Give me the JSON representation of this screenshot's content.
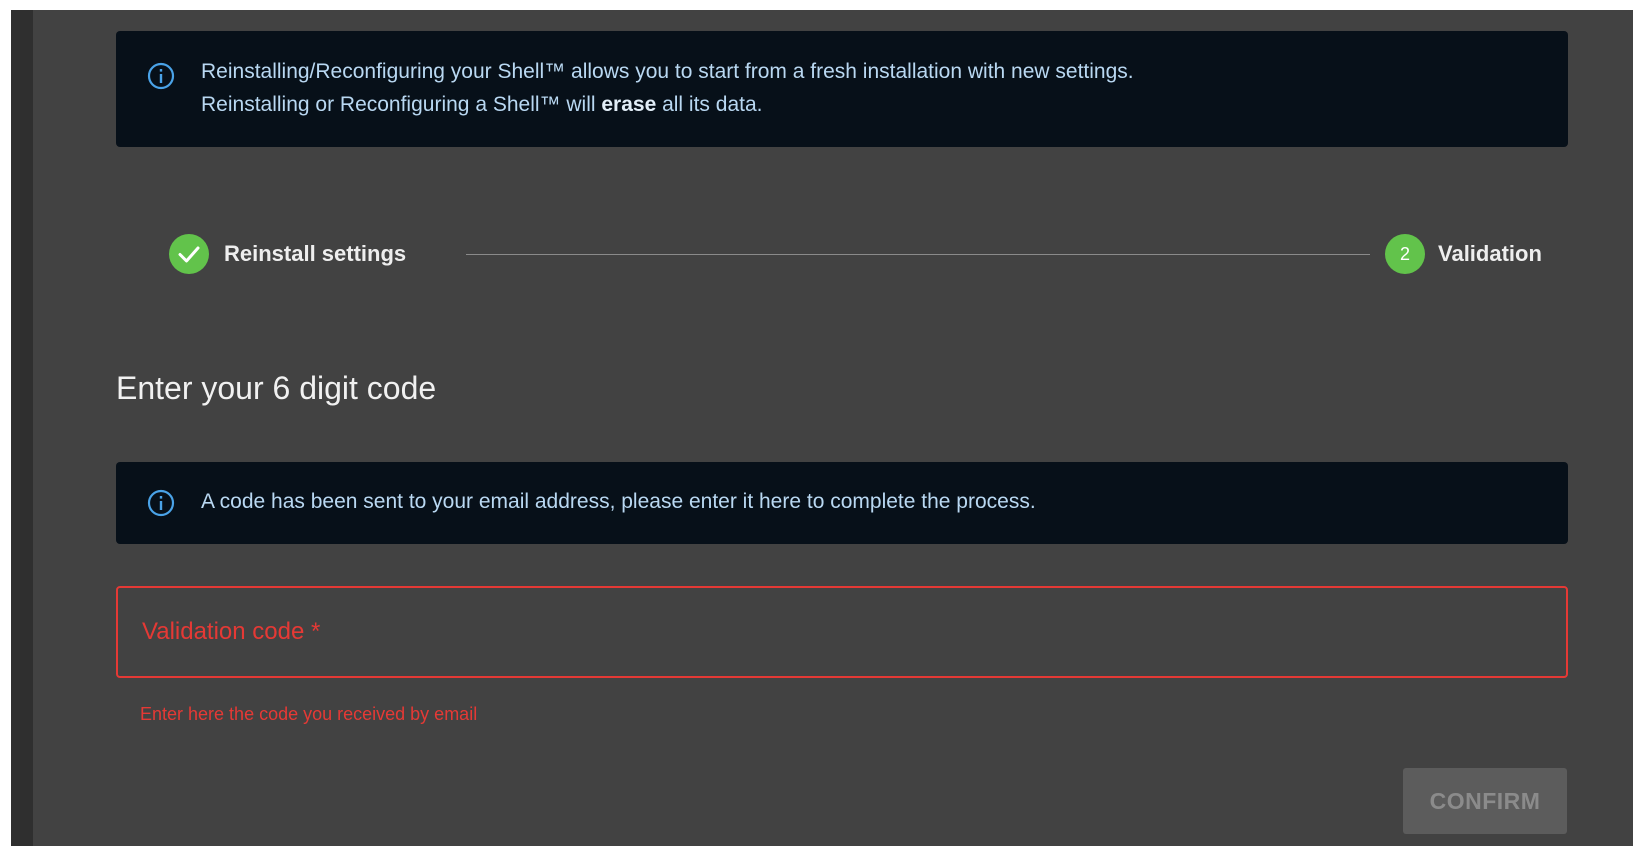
{
  "info_top": {
    "icon": "info-circle-icon",
    "line1": "Reinstalling/Reconfiguring your Shell™ allows you to start from a fresh installation with new settings.",
    "line2_prefix": "Reinstalling or Reconfiguring a Shell™ will ",
    "line2_bold": "erase",
    "line2_suffix": " all its data."
  },
  "stepper": {
    "steps": [
      {
        "label": "Reinstall settings",
        "state": "completed",
        "icon": "check-icon"
      },
      {
        "label": "Validation",
        "state": "active",
        "number": "2"
      }
    ]
  },
  "heading": "Enter your 6 digit code",
  "info_code": {
    "icon": "info-circle-icon",
    "text": "A code has been sent to your email address, please enter it here to complete the process."
  },
  "validation_field": {
    "label": "Validation code *",
    "value": "",
    "helper_text": "Enter here the code you received by email",
    "state": "error"
  },
  "confirm_button": {
    "label": "CONFIRM",
    "disabled": true
  },
  "colors": {
    "panel_background": "#424242",
    "info_background": "#071019",
    "info_text": "#b9d8f2",
    "step_green": "#62c34b",
    "error_red": "#e53935"
  }
}
